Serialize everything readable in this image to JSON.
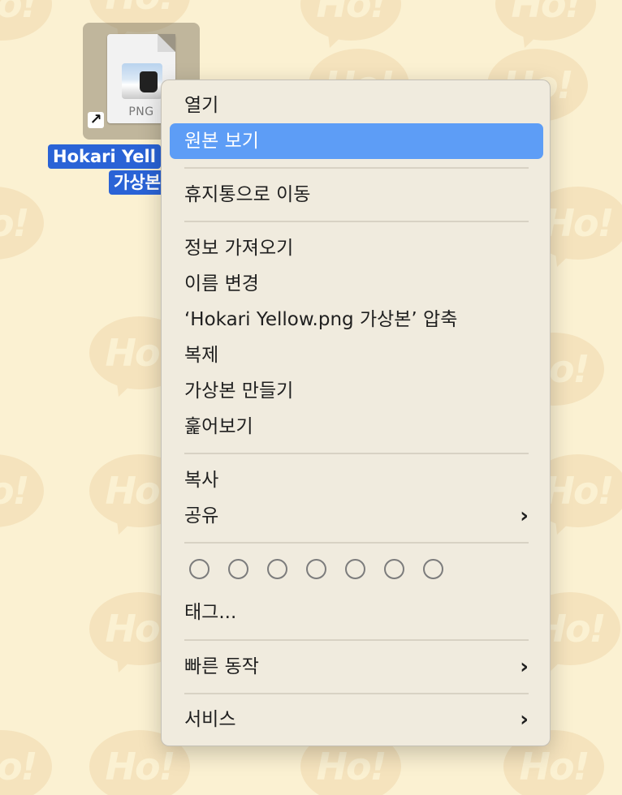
{
  "desktop": {
    "file_type_label": "PNG",
    "file_name_line1": "Hokari Yell",
    "file_name_line2": "가상본",
    "alias_arrow": "arrow-icon"
  },
  "menu": {
    "open": "열기",
    "show_original": "원본 보기",
    "move_to_trash": "휴지통으로 이동",
    "get_info": "정보 가져오기",
    "rename": "이름 변경",
    "compress": "‘Hokari Yellow.png 가상본’ 압축",
    "duplicate": "복제",
    "make_alias": "가상본 만들기",
    "quick_look": "훑어보기",
    "copy": "복사",
    "share": "공유",
    "tags_item": "태그...",
    "quick_actions": "빠른 동작",
    "services": "서비스",
    "submenu_chevron": "›",
    "highlight_color": "#5d9df6"
  },
  "tag_colors": [
    "none",
    "none",
    "none",
    "none",
    "none",
    "none",
    "none"
  ]
}
